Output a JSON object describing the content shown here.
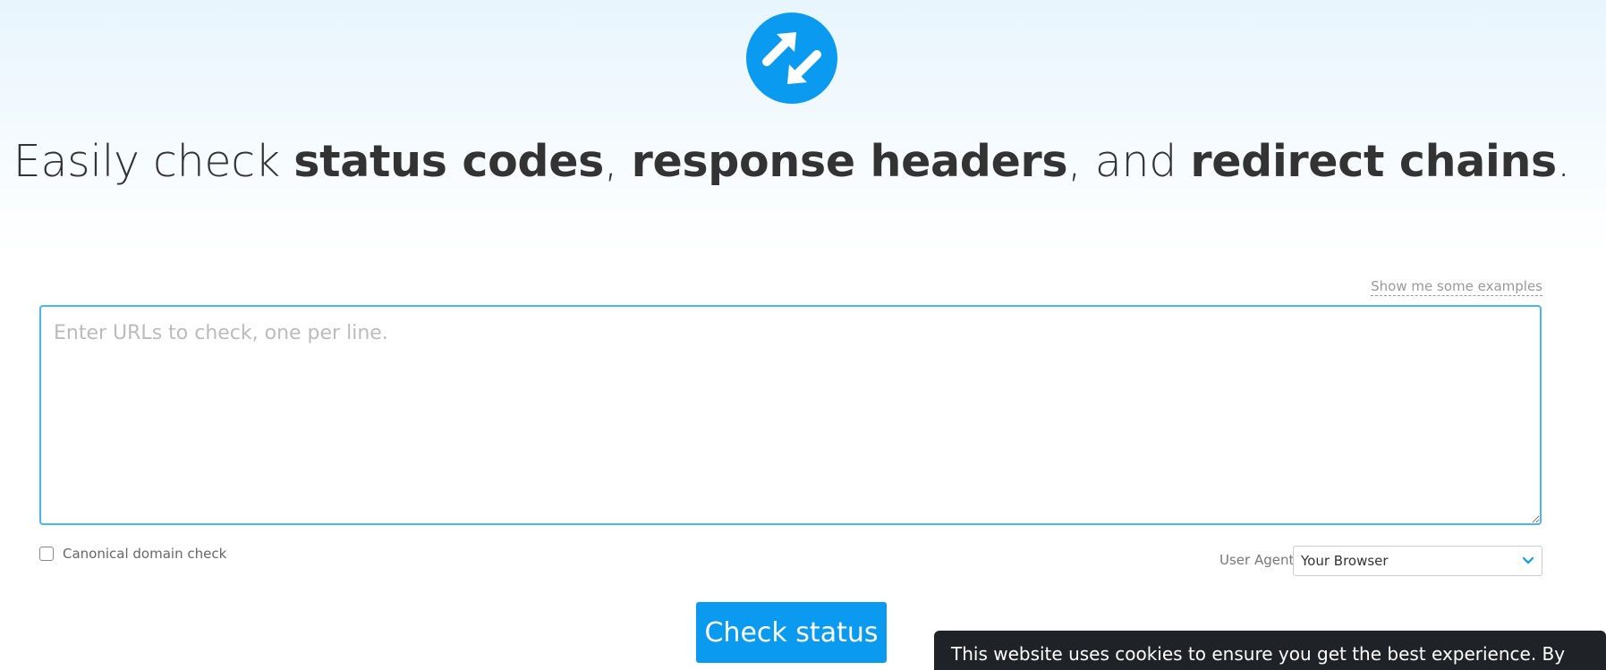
{
  "logo": {
    "icon": "redirect-arrows-icon",
    "color": "#0a9bf0"
  },
  "headline": {
    "part1": "Easily check ",
    "bold1": "status codes",
    "part2": ", ",
    "bold2": "response headers",
    "part3": ", and ",
    "bold3": "redirect chains",
    "part4": "."
  },
  "examples_link": "Show me some examples",
  "url_input": {
    "placeholder": "Enter URLs to check, one per line.",
    "value": ""
  },
  "canonical_check": {
    "label": "Canonical domain check",
    "checked": false
  },
  "user_agent": {
    "label": "User Agent:",
    "selected": "Your Browser",
    "icon": "chevron-down-icon"
  },
  "check_button": "Check status",
  "cookie_banner": {
    "text": "This website uses cookies to ensure you get the best experience. By"
  },
  "colors": {
    "accent": "#0a9bf0",
    "banner_bg": "#1f2328"
  }
}
